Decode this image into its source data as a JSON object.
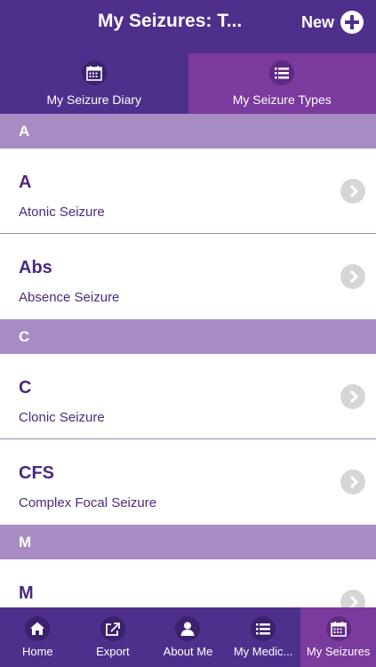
{
  "header": {
    "title": "My Seizures: T...",
    "new_label": "New"
  },
  "tabs": [
    {
      "label": "My Seizure Diary",
      "icon": "calendar-icon",
      "active": false
    },
    {
      "label": "My Seizure Types",
      "icon": "list-icon",
      "active": true
    }
  ],
  "sections": [
    {
      "letter": "A",
      "items": [
        {
          "abbr": "A",
          "name": "Atonic Seizure"
        },
        {
          "abbr": "Abs",
          "name": "Absence Seizure"
        }
      ]
    },
    {
      "letter": "C",
      "items": [
        {
          "abbr": "C",
          "name": "Clonic Seizure"
        },
        {
          "abbr": "CFS",
          "name": "Complex Focal Seizure"
        }
      ]
    },
    {
      "letter": "M",
      "items": [
        {
          "abbr": "M",
          "name": ""
        }
      ]
    }
  ],
  "bottom_nav": [
    {
      "label": "Home",
      "icon": "home-icon",
      "active": false
    },
    {
      "label": "Export",
      "icon": "export-icon",
      "active": false
    },
    {
      "label": "About Me",
      "icon": "person-icon",
      "active": false
    },
    {
      "label": "My Medic...",
      "icon": "list-icon",
      "active": false
    },
    {
      "label": "My Seizures",
      "icon": "calendar-icon",
      "active": true
    }
  ],
  "colors": {
    "header": "#4f2f8c",
    "active_tab": "#7a3a9e",
    "section_header": "#a98bc4",
    "text": "#4a2a80"
  }
}
